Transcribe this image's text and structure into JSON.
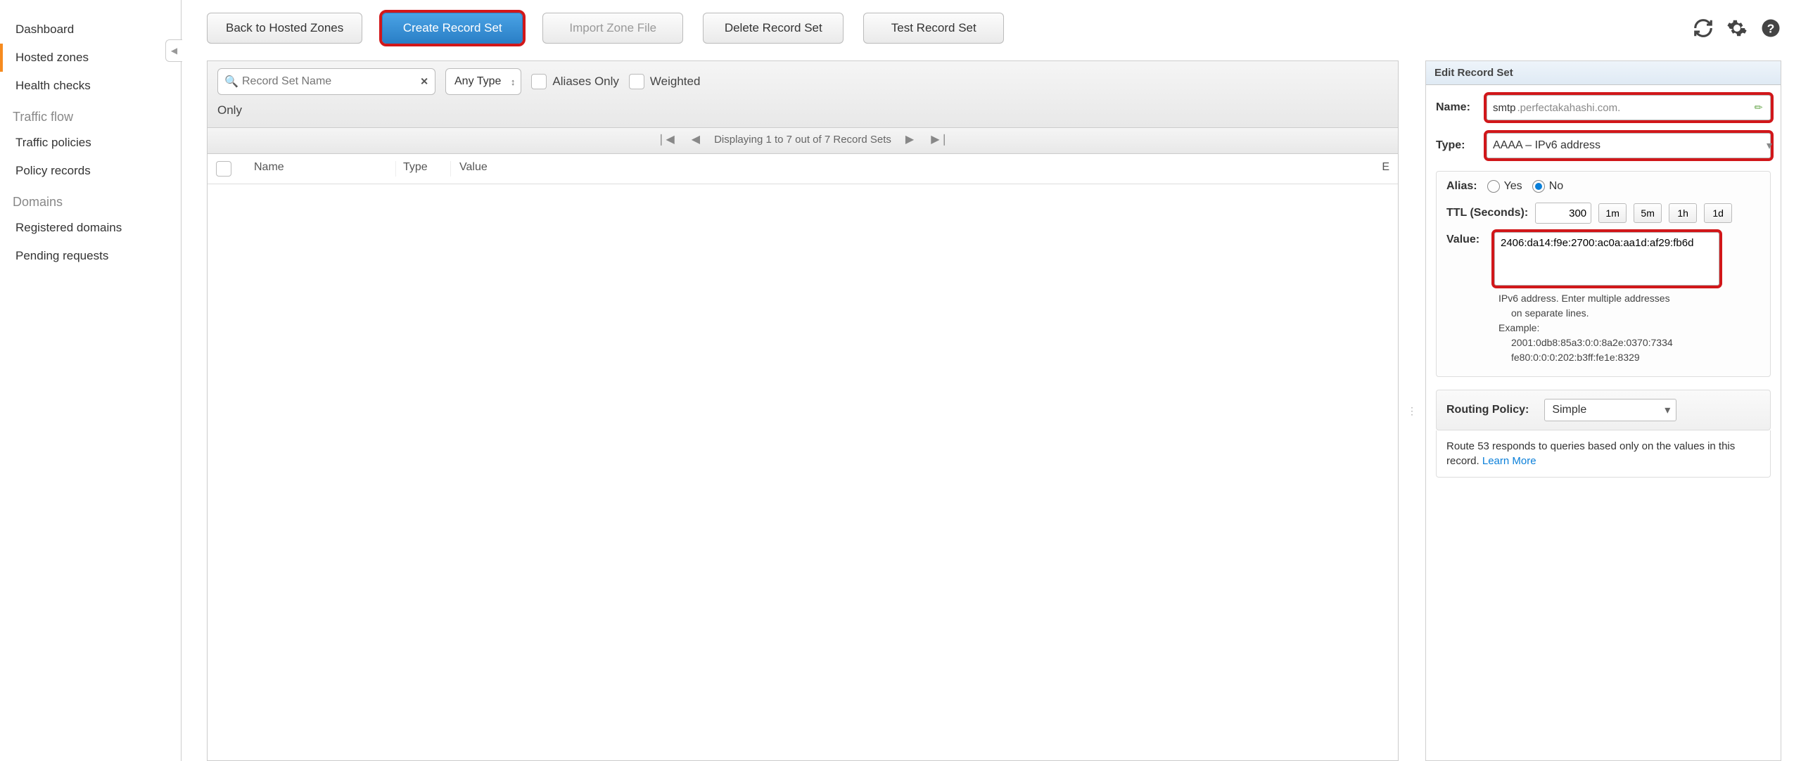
{
  "sidebar": {
    "items": [
      {
        "label": "Dashboard"
      },
      {
        "label": "Hosted zones"
      },
      {
        "label": "Health checks"
      }
    ],
    "sections": [
      {
        "title": "Traffic flow",
        "items": [
          {
            "label": "Traffic policies"
          },
          {
            "label": "Policy records"
          }
        ]
      },
      {
        "title": "Domains",
        "items": [
          {
            "label": "Registered domains"
          },
          {
            "label": "Pending requests"
          }
        ]
      }
    ]
  },
  "toolbar": {
    "back": "Back to Hosted Zones",
    "create": "Create Record Set",
    "import": "Import Zone File",
    "delete": "Delete Record Set",
    "test": "Test Record Set"
  },
  "filters": {
    "search_placeholder": "Record Set Name",
    "type_filter": "Any Type",
    "aliases_only": "Aliases Only",
    "weighted": "Weighted",
    "second_line": "Only"
  },
  "pager": {
    "text": "Displaying 1 to 7 out of 7 Record Sets"
  },
  "table": {
    "col_name": "Name",
    "col_type": "Type",
    "col_value": "Value",
    "col_e": "E"
  },
  "edit": {
    "header": "Edit Record Set",
    "name_label": "Name:",
    "name_value": "smtp",
    "name_domain": ".perfectakahashi.com.",
    "type_label": "Type:",
    "type_value": "AAAA – IPv6 address",
    "alias_label": "Alias:",
    "alias_yes": "Yes",
    "alias_no": "No",
    "ttl_label": "TTL (Seconds):",
    "ttl_value": "300",
    "ttl_buttons": [
      "1m",
      "5m",
      "1h",
      "1d"
    ],
    "value_label": "Value:",
    "value_text": "2406:da14:f9e:2700:ac0a:aa1d:af29:fb6d",
    "value_help1": "IPv6 address. Enter multiple addresses",
    "value_help2": "on separate lines.",
    "value_help3": "Example:",
    "value_help4": "2001:0db8:85a3:0:0:8a2e:0370:7334",
    "value_help5": "fe80:0:0:0:202:b3ff:fe1e:8329",
    "routing_label": "Routing Policy:",
    "routing_value": "Simple",
    "routing_desc": "Route 53 responds to queries based only on the values in this record.  ",
    "learn_more": "Learn More"
  }
}
